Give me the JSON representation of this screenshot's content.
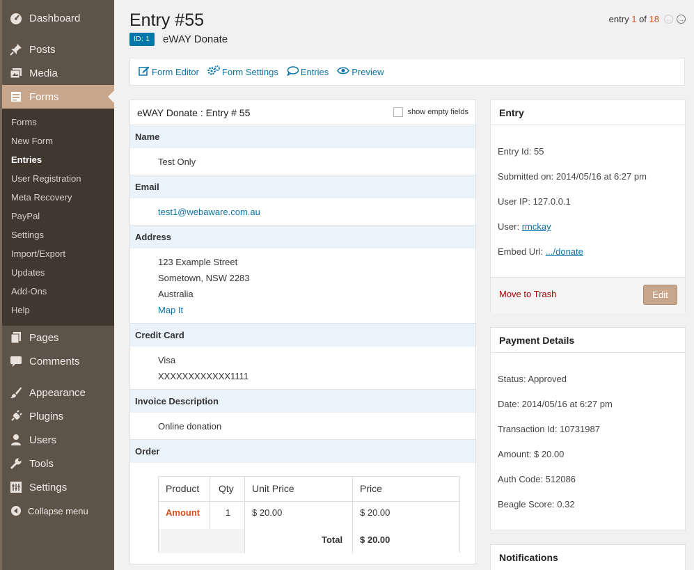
{
  "sidebar": {
    "top_items": [
      {
        "label": "Dashboard",
        "icon": "dashboard-icon"
      },
      {
        "label": "Posts",
        "icon": "pin-icon"
      },
      {
        "label": "Media",
        "icon": "media-icon"
      },
      {
        "label": "Forms",
        "icon": "forms-icon"
      }
    ],
    "submenu": [
      "Forms",
      "New Form",
      "Entries",
      "User Registration",
      "Meta Recovery",
      "PayPal",
      "Settings",
      "Import/Export",
      "Updates",
      "Add-Ons",
      "Help"
    ],
    "bottom_items": [
      {
        "label": "Pages",
        "icon": "pages-icon"
      },
      {
        "label": "Comments",
        "icon": "comment-icon"
      },
      {
        "label": "Appearance",
        "icon": "brush-icon"
      },
      {
        "label": "Plugins",
        "icon": "plug-icon"
      },
      {
        "label": "Users",
        "icon": "user-icon"
      },
      {
        "label": "Tools",
        "icon": "wrench-icon"
      },
      {
        "label": "Settings",
        "icon": "settings-icon"
      },
      {
        "label": "Collapse menu",
        "icon": "collapse-icon"
      }
    ]
  },
  "header": {
    "title": "Entry #55",
    "id_badge": "ID: 1",
    "form_name": "eWAY Donate",
    "pager_prefix": "entry",
    "pager_current": "1",
    "pager_of": "of",
    "pager_total": "18"
  },
  "toolbar": {
    "form_editor": "Form Editor",
    "form_settings": "Form Settings",
    "entries": "Entries",
    "preview": "Preview"
  },
  "detail": {
    "title": "eWAY Donate : Entry # 55",
    "show_empty": "show empty fields",
    "name_label": "Name",
    "name_value": "Test Only",
    "email_label": "Email",
    "email_value": "test1@webaware.com.au",
    "address_label": "Address",
    "address_line1": "123 Example Street",
    "address_line2": "Sometown, NSW 2283",
    "address_line3": "Australia",
    "map_it": "Map It",
    "cc_label": "Credit Card",
    "cc_type": "Visa",
    "cc_number": "XXXXXXXXXXXX1111",
    "invoice_label": "Invoice Description",
    "invoice_value": "Online donation",
    "order_label": "Order",
    "order": {
      "headers": [
        "Product",
        "Qty",
        "Unit Price",
        "Price"
      ],
      "row": {
        "product": "Amount",
        "qty": "1",
        "unit_price": "$ 20.00",
        "price": "$ 20.00"
      },
      "total_label": "Total",
      "total_value": "$ 20.00"
    }
  },
  "entry_box": {
    "title": "Entry",
    "entry_id": "Entry Id: 55",
    "submitted": "Submitted on: 2014/05/16 at 6:27 pm",
    "user_ip": "User IP: 127.0.0.1",
    "user_label": "User:",
    "user_value": "rmckay",
    "embed_label": "Embed Url:",
    "embed_value": ".../donate",
    "trash": "Move to Trash",
    "edit": "Edit"
  },
  "payment_box": {
    "title": "Payment Details",
    "status": "Status: Approved",
    "date": "Date: 2014/05/16 at 6:27 pm",
    "transaction": "Transaction Id: 10731987",
    "amount": "Amount: $ 20.00",
    "auth": "Auth Code: 512086",
    "beagle": "Beagle Score: 0.32"
  },
  "notifications_box": {
    "title": "Notifications"
  }
}
